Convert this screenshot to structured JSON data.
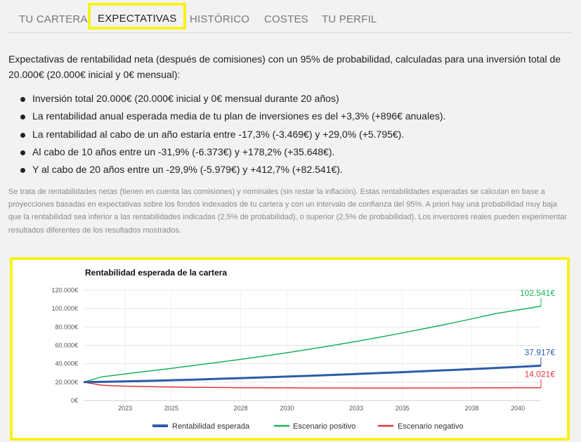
{
  "tabs": [
    {
      "label": "TU CARTERA",
      "active": false
    },
    {
      "label": "EXPECTATIVAS",
      "active": true
    },
    {
      "label": "HISTÓRICO",
      "active": false
    },
    {
      "label": "COSTES",
      "active": false
    },
    {
      "label": "TU PERFIL",
      "active": false
    }
  ],
  "intro": "Expectativas de rentabilidad neta (después de comisiones) con un 95% de probabilidad, calculadas para una inversión total de 20.000€ (20.000€ inicial y 0€ mensual):",
  "bullets": [
    "Inversión total 20.000€ (20.000€ inicial y 0€ mensual durante 20 años)",
    "La rentabilidad anual esperada media de tu plan de inversiones es del +3,3% (+896€ anuales).",
    "La rentabilidad al cabo de un año estaría entre -17,3% (-3.469€) y +29,0% (+5.795€).",
    "Al cabo de 10 años entre un -31,9% (-6.373€) y +178,2% (+35.648€).",
    "Y al cabo de 20 años entre un -29,9% (-5.979€) y +412,7% (+82.541€)."
  ],
  "note": "Se trata de rentabilidades netas (tienen en cuenta las comisiones) y nominales (sin restar la inflación). Estas rentabilidades esperadas se calculan en base a proyecciones basadas en expectativas sobre los fondos indexados de tu cartera y con un intervalo de confianza del 95%. A priori hay una probabilidad muy baja que la rentabilidad sea inferior a las rentabilidades indicadas (2,5% de probabilidad), o superior (2,5% de probabilidad). Los inversores reales pueden experimentar resultados diferentes de los resultados mostrados.",
  "chart_data": {
    "type": "line",
    "title": "Rentabilidad esperada de la cartera",
    "xlabel": "",
    "ylabel": "",
    "x_ticks": [
      2023,
      2025,
      2028,
      2030,
      2033,
      2035,
      2038,
      2040
    ],
    "y_ticks": [
      "0€",
      "20.000€",
      "40.000€",
      "60.000€",
      "80.000€",
      "100.000€",
      "120.000€"
    ],
    "ylim": [
      0,
      120000
    ],
    "xlim": [
      2021.2,
      2041
    ],
    "grid": true,
    "legend_position": "bottom",
    "series": [
      {
        "name": "Rentabilidad esperada",
        "color": "#2b5ca8",
        "x": [
          2021.2,
          2022,
          2023,
          2024,
          2025,
          2026,
          2027,
          2028,
          2029,
          2030,
          2031,
          2032,
          2033,
          2034,
          2035,
          2036,
          2037,
          2038,
          2039,
          2040,
          2041
        ],
        "values": [
          20000,
          20300,
          20800,
          21400,
          22100,
          22800,
          23600,
          24400,
          25200,
          26100,
          27000,
          27900,
          28900,
          29900,
          30900,
          32000,
          33100,
          34200,
          35400,
          36600,
          37917
        ],
        "end_label": "37.917€"
      },
      {
        "name": "Escenario positivo",
        "color": "#19b35a",
        "x": [
          2021.2,
          2022,
          2023,
          2024,
          2025,
          2026,
          2027,
          2028,
          2029,
          2030,
          2031,
          2032,
          2033,
          2034,
          2035,
          2036,
          2037,
          2038,
          2039,
          2040,
          2041
        ],
        "values": [
          20000,
          25800,
          29000,
          32000,
          35000,
          38200,
          41400,
          44800,
          48300,
          52000,
          55900,
          60000,
          64300,
          68800,
          73500,
          78400,
          83500,
          88800,
          94400,
          98500,
          102541
        ],
        "end_label": "102.541€"
      },
      {
        "name": "Escenario negativo",
        "color": "#e0353a",
        "x": [
          2021.2,
          2022,
          2023,
          2024,
          2025,
          2026,
          2027,
          2028,
          2029,
          2030,
          2031,
          2032,
          2033,
          2034,
          2035,
          2036,
          2037,
          2038,
          2039,
          2040,
          2041
        ],
        "values": [
          20000,
          16600,
          15700,
          15100,
          14700,
          14400,
          14200,
          14000,
          13900,
          13800,
          13700,
          13650,
          13600,
          13600,
          13600,
          13650,
          13700,
          13750,
          13850,
          13950,
          14021
        ],
        "end_label": "14.021€"
      }
    ]
  }
}
